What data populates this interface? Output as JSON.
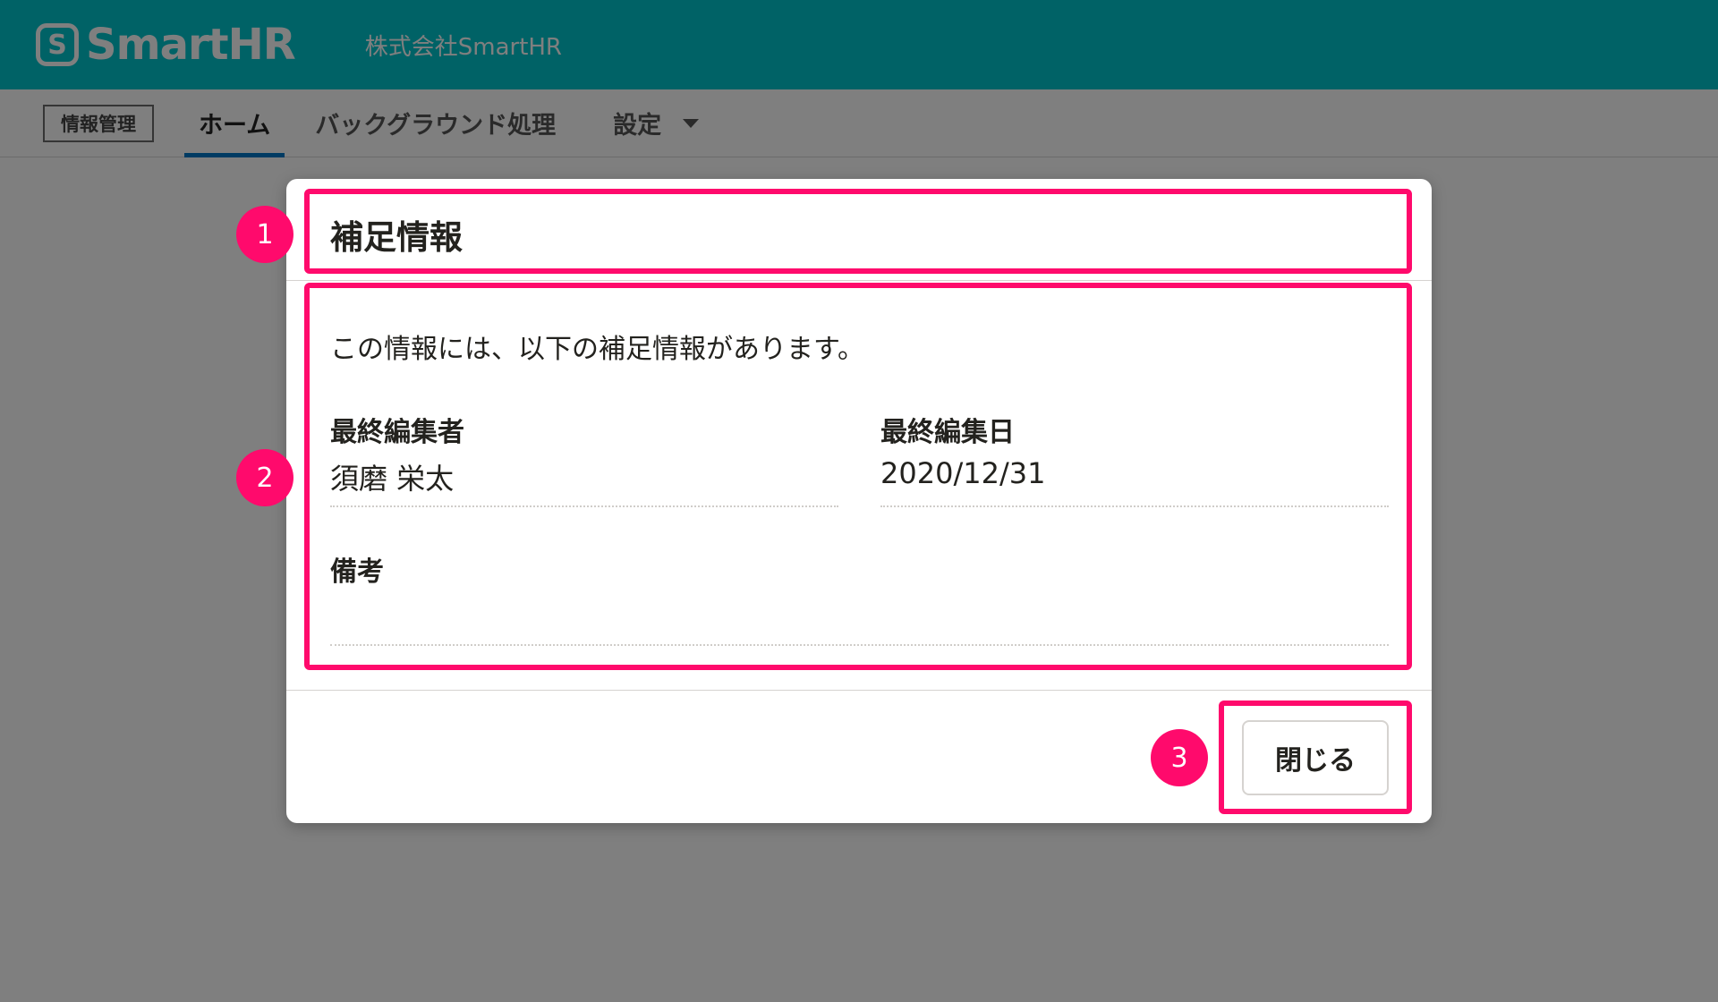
{
  "header": {
    "logo_mark": "S",
    "logo_text": "SmartHR",
    "company": "株式会社SmartHR"
  },
  "tabbar": {
    "app_badge": "情報管理",
    "tabs": [
      {
        "label": "ホーム"
      },
      {
        "label": "バックグラウンド処理"
      },
      {
        "label": "設定"
      }
    ]
  },
  "dialog": {
    "title": "補足情報",
    "description": "この情報には、以下の補足情報があります。",
    "fields": [
      {
        "label": "最終編集者",
        "value": "須磨 栄太"
      },
      {
        "label": "最終編集日",
        "value": "2020/12/31"
      },
      {
        "label": "備考",
        "value": ""
      }
    ],
    "close_label": "閉じる"
  },
  "annotations": [
    "1",
    "2",
    "3"
  ],
  "colors": {
    "header_bg": "#00c4cc",
    "tab_indicator": "#0077c7",
    "annotation": "#ff0a6c"
  }
}
